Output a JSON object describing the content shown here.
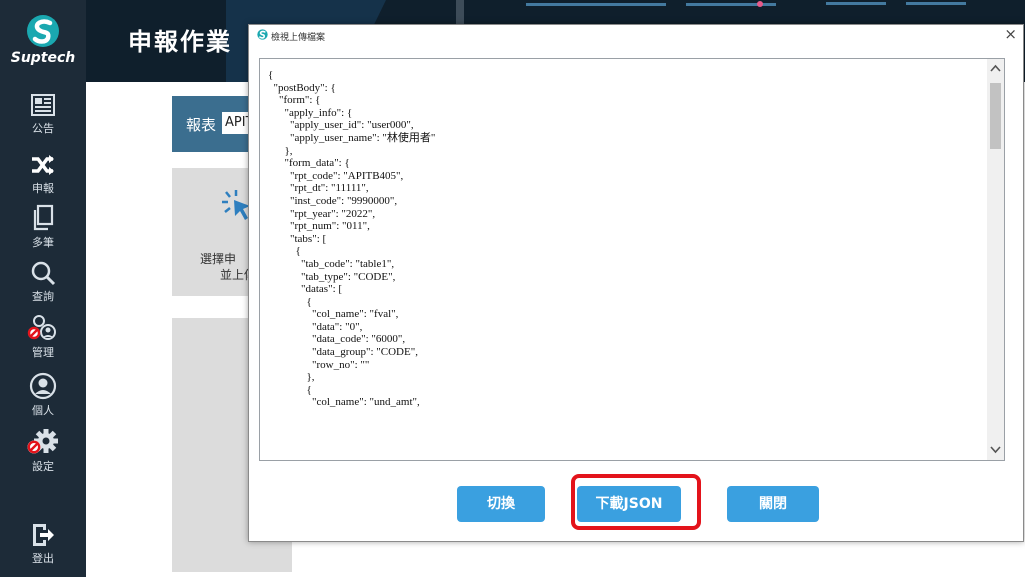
{
  "sidebar": {
    "logo_text": "Suptech",
    "items": [
      {
        "label": "公告",
        "icon": "newspaper-icon"
      },
      {
        "label": "申報",
        "icon": "shuffle-icon"
      },
      {
        "label": "多筆",
        "icon": "copy-icon"
      },
      {
        "label": "查詢",
        "icon": "search-icon"
      },
      {
        "label": "管理",
        "icon": "users-admin-icon"
      },
      {
        "label": "個人",
        "icon": "user-circle-icon"
      },
      {
        "label": "設定",
        "icon": "gear-icon"
      },
      {
        "label": "登出",
        "icon": "logout-icon"
      }
    ]
  },
  "header": {
    "title": "申報作業"
  },
  "main": {
    "report_label": "報表",
    "report_value": "APIT",
    "upload_text_line1": "選擇申",
    "upload_text_line2": "並上傳"
  },
  "modal": {
    "title": "檢視上傳檔案",
    "close_symbol": "×",
    "json_content": "{\n  \"postBody\": {\n    \"form\": {\n      \"apply_info\": {\n        \"apply_user_id\": \"user000\",\n        \"apply_user_name\": \"林使用者\"\n      },\n      \"form_data\": {\n        \"rpt_code\": \"APITB405\",\n        \"rpt_dt\": \"11111\",\n        \"inst_code\": \"9990000\",\n        \"rpt_year\": \"2022\",\n        \"rpt_num\": \"011\",\n        \"tabs\": [\n          {\n            \"tab_code\": \"table1\",\n            \"tab_type\": \"CODE\",\n            \"datas\": [\n              {\n                \"col_name\": \"fval\",\n                \"data\": \"0\",\n                \"data_code\": \"6000\",\n                \"data_group\": \"CODE\",\n                \"row_no\": \"\"\n              },\n              {\n                \"col_name\": \"und_amt\",",
    "buttons": {
      "switch": "切換",
      "download": "下載JSON",
      "close": "關閉"
    }
  },
  "colors": {
    "sidebar_bg": "#1d2b38",
    "header_bg": "#0f1f2c",
    "button_blue": "#3aa0e0",
    "highlight_red": "#e3131b"
  }
}
